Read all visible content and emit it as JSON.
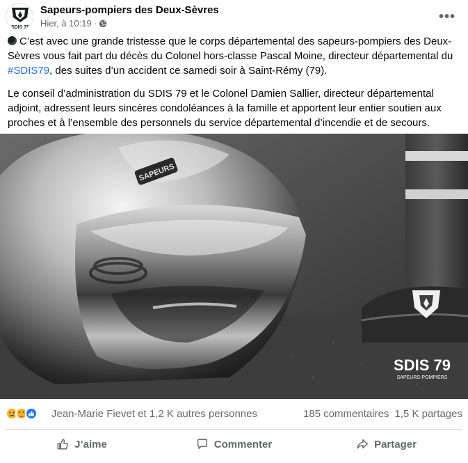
{
  "post": {
    "page_name": "Sapeurs-pompiers des Deux-Sèvres",
    "timestamp": "Hier, à 10:19",
    "separator": "·",
    "avatar_label": "SDIS 79",
    "more_icon": "more-horizontal-icon",
    "privacy_icon": "globe-icon"
  },
  "content": {
    "paragraph_1_start": "C’est avec une grande tristesse que le corps départemental des sapeurs-pompiers des Deux-Sèvres vous fait part du décès du Colonel hors-classe Pascal Moine, directeur départemental du ",
    "hashtag": "#SDIS79",
    "paragraph_1_end": ", des suites d’un accident ce samedi soir à Saint-Rémy (79).",
    "paragraph_2": "Le conseil d’administration du SDIS 79 et le Colonel Damien Sallier, directeur départemental adjoint, adressent leurs sincères condoléances à la famille et apportent leur entier soutien aux proches et à l’ensemble des personnels du service départemental d’incendie et de secours."
  },
  "image": {
    "helmet_text": "SAPEURS",
    "logo_title": "SDIS 79",
    "logo_subtitle": "SAPEURS-POMPIERS"
  },
  "stats": {
    "reaction_names": "Jean-Marie Fievet et 1,2 K autres personnes",
    "comments": "185 commentaires",
    "shares": "1,5 K partages"
  },
  "actions": {
    "like": "J’aime",
    "comment": "Commenter",
    "share": "Partager"
  },
  "colors": {
    "hashtag": "#216fdb",
    "secondary_text": "#65676b",
    "like_blue": "#1877f2",
    "reaction_yellow": "#f7b125"
  }
}
